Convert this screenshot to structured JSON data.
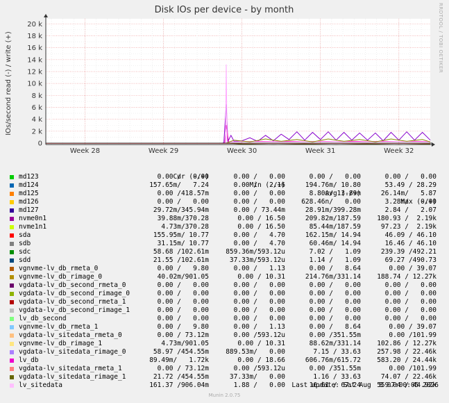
{
  "chart_data": {
    "type": "line",
    "title": "Disk IOs per device - by month",
    "ylabel": "IOs/second read (-) / write (+)",
    "ylim": [
      0,
      20500
    ],
    "y_ticks": [
      0,
      2000,
      4000,
      6000,
      8000,
      10000,
      12000,
      14000,
      16000,
      18000,
      20000
    ],
    "y_tick_labels": [
      "0",
      "2 k",
      "4 k",
      "6 k",
      "8 k",
      "10 k",
      "12 k",
      "14 k",
      "16 k",
      "18 k",
      "20 k"
    ],
    "x_range_weeks": [
      27.5,
      32.4
    ],
    "x_ticks": [
      28,
      29,
      30,
      31,
      32
    ],
    "x_tick_labels": [
      "Week 28",
      "Week 29",
      "Week 30",
      "Week 31",
      "Week 32"
    ],
    "grid": true,
    "series": [
      {
        "name": "nvme0n1",
        "color": "#8800cc",
        "points": [
          [
            27.5,
            0
          ],
          [
            29.75,
            0
          ],
          [
            29.77,
            80
          ],
          [
            29.8,
            6500
          ],
          [
            29.82,
            250
          ],
          [
            29.86,
            1300
          ],
          [
            29.9,
            300
          ],
          [
            30,
            400
          ],
          [
            30.1,
            900
          ],
          [
            30.2,
            300
          ],
          [
            30.3,
            1300
          ],
          [
            30.4,
            400
          ],
          [
            30.5,
            1500
          ],
          [
            30.6,
            600
          ],
          [
            30.7,
            1900
          ],
          [
            30.8,
            500
          ],
          [
            30.9,
            1800
          ],
          [
            31,
            600
          ],
          [
            31.1,
            1900
          ],
          [
            31.2,
            500
          ],
          [
            31.3,
            1800
          ],
          [
            31.4,
            500
          ],
          [
            31.5,
            1700
          ],
          [
            31.6,
            500
          ],
          [
            31.7,
            1700
          ],
          [
            31.8,
            400
          ],
          [
            31.9,
            1800
          ],
          [
            32,
            500
          ],
          [
            32.1,
            1900
          ],
          [
            32.2,
            500
          ],
          [
            32.3,
            1800
          ],
          [
            32.4,
            500
          ]
        ]
      },
      {
        "name": "lv_db",
        "color": "#ee00aa",
        "points": [
          [
            27.5,
            0
          ],
          [
            29.78,
            0
          ],
          [
            29.8,
            3000
          ],
          [
            29.83,
            200
          ],
          [
            30,
            250
          ],
          [
            30.2,
            300
          ],
          [
            30.4,
            250
          ],
          [
            30.6,
            300
          ],
          [
            30.8,
            250
          ],
          [
            31,
            300
          ],
          [
            31.2,
            250
          ],
          [
            31.4,
            300
          ],
          [
            31.6,
            250
          ],
          [
            31.8,
            300
          ],
          [
            32,
            250
          ],
          [
            32.2,
            300
          ],
          [
            32.4,
            250
          ]
        ]
      },
      {
        "name": "lv_sitedata",
        "color": "#ffaaff",
        "points": [
          [
            27.5,
            0
          ],
          [
            29.79,
            0
          ],
          [
            29.8,
            13200
          ],
          [
            29.81,
            0
          ],
          [
            29.85,
            200
          ],
          [
            30.1,
            250
          ],
          [
            30.5,
            200
          ],
          [
            31,
            250
          ],
          [
            31.5,
            200
          ],
          [
            32,
            250
          ],
          [
            32.4,
            200
          ]
        ]
      },
      {
        "name": "vgnvme-lv_db_rimage_0",
        "color": "#888800",
        "points": [
          [
            27.5,
            0
          ],
          [
            29.8,
            0
          ],
          [
            29.9,
            500
          ],
          [
            30.1,
            200
          ],
          [
            30.3,
            700
          ],
          [
            30.5,
            300
          ],
          [
            30.7,
            600
          ],
          [
            30.9,
            200
          ],
          [
            31.1,
            700
          ],
          [
            31.3,
            300
          ],
          [
            31.5,
            600
          ],
          [
            31.7,
            200
          ],
          [
            31.9,
            700
          ],
          [
            32.1,
            300
          ],
          [
            32.3,
            600
          ],
          [
            32.4,
            200
          ]
        ]
      },
      {
        "name": "vgdata-lv_sitedata_rimage_1",
        "color": "#666600",
        "points": [
          [
            27.5,
            0
          ],
          [
            29.8,
            0
          ],
          [
            30,
            -150
          ],
          [
            30.4,
            -250
          ],
          [
            30.8,
            -150
          ],
          [
            31.2,
            -250
          ],
          [
            31.6,
            -150
          ],
          [
            32,
            -250
          ],
          [
            32.4,
            -150
          ]
        ]
      },
      {
        "name": "sda",
        "color": "#ff0000",
        "points": [
          [
            27.5,
            -30
          ],
          [
            32.4,
            -30
          ]
        ]
      }
    ]
  },
  "legend": {
    "header": {
      "cur": "Cur (-/+)",
      "min": "Min (-/+)",
      "avg": "Avg (-/+)",
      "max": "Max (-/+)"
    },
    "rows": [
      {
        "name": "md123",
        "color": "#00cc00",
        "cur": "0.00 /   0.00",
        "min": "0.00 /   0.00",
        "avg": "0.00 /   0.00",
        "max": "0.00 /   0.00"
      },
      {
        "name": "md124",
        "color": "#0066b3",
        "cur": "157.65m/   7.24",
        "min": "0.00 /   2.16",
        "avg": "194.76m/ 10.80",
        "max": "53.49 / 28.29"
      },
      {
        "name": "md125",
        "color": "#ff8000",
        "cur": "0.00 /418.57m",
        "min": "0.00 /   0.00",
        "avg": "8.80u/ 13.89m",
        "max": "26.14m/   5.87"
      },
      {
        "name": "md126",
        "color": "#ffcc00",
        "cur": "0.00 /   0.00",
        "min": "0.00 /   0.00",
        "avg": "628.46n/   0.00",
        "max": "3.28m/   0.00"
      },
      {
        "name": "md127",
        "color": "#330099",
        "cur": "29.72m/345.94m",
        "min": "0.00 / 73.44m",
        "avg": "28.91m/399.28m",
        "max": "2.84 /   2.07"
      },
      {
        "name": "nvme0n1",
        "color": "#990099",
        "cur": "39.88m/370.28",
        "min": "0.00 / 16.50",
        "avg": "209.82m/187.59",
        "max": "180.93 /  2.19k"
      },
      {
        "name": "nvme1n1",
        "color": "#ccff00",
        "cur": "4.73m/370.28",
        "min": "0.00 / 16.50",
        "avg": "85.44m/187.59",
        "max": "97.23 /  2.19k"
      },
      {
        "name": "sda",
        "color": "#ff0000",
        "cur": "155.95m/ 10.77",
        "min": "0.00 /   4.70",
        "avg": "162.15m/ 14.94",
        "max": "46.09 / 46.10"
      },
      {
        "name": "sdb",
        "color": "#808080",
        "cur": "31.15m/ 10.77",
        "min": "0.00 /   4.70",
        "avg": "60.46m/ 14.94",
        "max": "16.46 / 46.10"
      },
      {
        "name": "sdc",
        "color": "#008f00",
        "cur": "58.68 /102.61m",
        "min": "859.36m/593.12u",
        "avg": "7.02 /   1.09",
        "max": "239.39 /492.21"
      },
      {
        "name": "sdd",
        "color": "#00487d",
        "cur": "21.55 /102.61m",
        "min": "37.33m/593.12u",
        "avg": "1.14 /   1.09",
        "max": "69.27 /490.73"
      },
      {
        "name": "vgnvme-lv_db_rmeta_0",
        "color": "#b35a00",
        "cur": "0.00 /   9.80",
        "min": "0.00 /   1.13",
        "avg": "0.00 /   8.64",
        "max": "0.00 / 39.07"
      },
      {
        "name": "vgnvme-lv_db_rimage_0",
        "color": "#b38f00",
        "cur": "40.02m/901.05",
        "min": "0.00 / 10.31",
        "avg": "214.76m/331.14",
        "max": "188.74 / 12.27k"
      },
      {
        "name": "vgdata-lv_db_second_rmeta_0",
        "color": "#6b006b",
        "cur": "0.00 /   0.00",
        "min": "0.00 /   0.00",
        "avg": "0.00 /   0.00",
        "max": "0.00 /   0.00"
      },
      {
        "name": "vgdata-lv_db_second_rimage_0",
        "color": "#8fb300",
        "cur": "0.00 /   0.00",
        "min": "0.00 /   0.00",
        "avg": "0.00 /   0.00",
        "max": "0.00 /   0.00"
      },
      {
        "name": "vgdata-lv_db_second_rmeta_1",
        "color": "#b30000",
        "cur": "0.00 /   0.00",
        "min": "0.00 /   0.00",
        "avg": "0.00 /   0.00",
        "max": "0.00 /   0.00"
      },
      {
        "name": "vgdata-lv_db_second_rimage_1",
        "color": "#bebebe",
        "cur": "0.00 /   0.00",
        "min": "0.00 /   0.00",
        "avg": "0.00 /   0.00",
        "max": "0.00 /   0.00"
      },
      {
        "name": "lv_db_second",
        "color": "#80ff80",
        "cur": "0.00 /   0.00",
        "min": "0.00 /   0.00",
        "avg": "0.00 /   0.00",
        "max": "0.00 /   0.00"
      },
      {
        "name": "vgnvme-lv_db_rmeta_1",
        "color": "#80c9ff",
        "cur": "0.00 /   9.80",
        "min": "0.00 /   1.13",
        "avg": "0.00 /   8.64",
        "max": "0.00 / 39.07"
      },
      {
        "name": "vgdata-lv_sitedata_rmeta_0",
        "color": "#ffc080",
        "cur": "0.00 / 73.12m",
        "min": "0.00 /593.12u",
        "avg": "0.00 /351.55m",
        "max": "0.00 /101.99"
      },
      {
        "name": "vgnvme-lv_db_rimage_1",
        "color": "#ffe680",
        "cur": "4.73m/901.05",
        "min": "0.00 / 10.31",
        "avg": "88.62m/331.14",
        "max": "102.86 / 12.27k"
      },
      {
        "name": "vgdata-lv_sitedata_rimage_0",
        "color": "#aa80ff",
        "cur": "58.97 /454.55m",
        "min": "889.53m/   0.00",
        "avg": "7.15 / 33.63",
        "max": "257.98 / 22.46k"
      },
      {
        "name": "lv_db",
        "color": "#ee00cc",
        "cur": "89.49m/   1.72k",
        "min": "0.00 / 18.66",
        "avg": "606.76m/615.72",
        "max": "583.20 / 24.44k"
      },
      {
        "name": "vgdata-lv_sitedata_rmeta_1",
        "color": "#ff8080",
        "cur": "0.00 / 73.12m",
        "min": "0.00 /593.12u",
        "avg": "0.00 /351.55m",
        "max": "0.00 /101.99"
      },
      {
        "name": "vgdata-lv_sitedata_rimage_1",
        "color": "#666600",
        "cur": "21.72 /454.55m",
        "min": "37.33m/   0.00",
        "avg": "1.16 / 33.63",
        "max": "74.07 / 22.46k"
      },
      {
        "name": "lv_sitedata",
        "color": "#ffbfff",
        "cur": "161.37 /906.04m",
        "min": "1.88 /   0.00",
        "avg": "16.61 / 67.24",
        "max": "559.04 / 44.92k"
      }
    ]
  },
  "last_update": "Last update: Sat Aug  8 07:00:05 2026",
  "footer": "Munin 2.0.75",
  "side_label": "RRDTOOL / TOBI OETIKER"
}
